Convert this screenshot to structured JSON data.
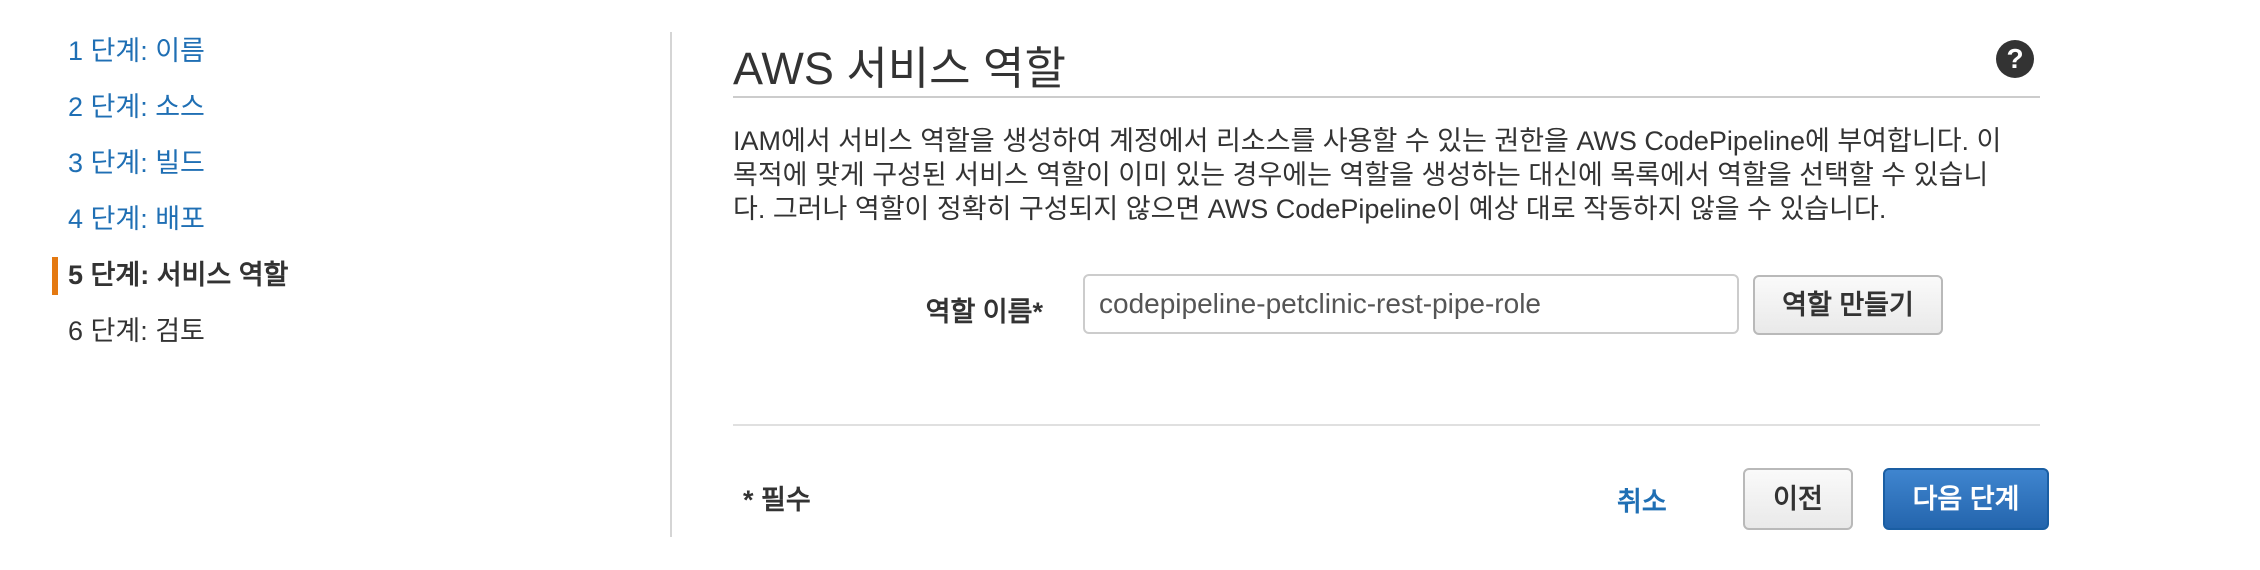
{
  "sidebar": {
    "steps": [
      {
        "label": "1 단계: 이름",
        "state": "link"
      },
      {
        "label": "2 단계: 소스",
        "state": "link"
      },
      {
        "label": "3 단계: 빌드",
        "state": "link"
      },
      {
        "label": "4 단계: 배포",
        "state": "link"
      },
      {
        "label": "5 단계: 서비스 역할",
        "state": "active"
      },
      {
        "label": "6 단계: 검토",
        "state": "plain"
      }
    ]
  },
  "main": {
    "title": "AWS 서비스 역할",
    "help_icon": "question-circle-icon",
    "description_lines": [
      "IAM에서 서비스 역할을 생성하여 계정에서 리소스를 사용할 수 있는 권한을 AWS CodePipeline에 부여합니다. 이",
      "목적에 맞게 구성된 서비스 역할이 이미 있는 경우에는 역할을 생성하는 대신에 목록에서 역할을 선택할 수 있습니",
      "다. 그러나 역할이 정확히 구성되지 않으면 AWS CodePipeline이 예상 대로 작동하지 않을 수 있습니다."
    ],
    "role": {
      "label": "역할 이름*",
      "value": "codepipeline-petclinic-rest-pipe-role",
      "create_button": "역할 만들기"
    }
  },
  "footer": {
    "required_note": "* 필수",
    "cancel": "취소",
    "previous": "이전",
    "next": "다음 단계"
  },
  "colors": {
    "link": "#1f6fb4",
    "active_marker": "#e47911",
    "primary_button": "#2e6fb7"
  }
}
